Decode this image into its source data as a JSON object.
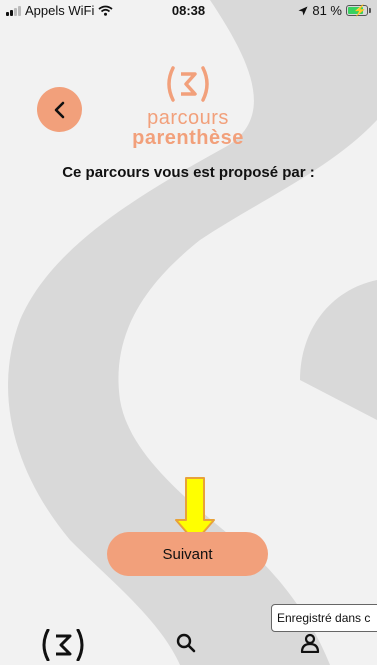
{
  "status_bar": {
    "carrier": "Appels WiFi",
    "time": "08:38",
    "battery_percent": "81 %",
    "battery_level": 0.81,
    "icons": [
      "signal-icon",
      "wifi-icon",
      "location-arrow-icon",
      "battery-charging-icon"
    ]
  },
  "logo": {
    "line1": "parcours",
    "line2": "parenthèse"
  },
  "page": {
    "title": "Ce parcours vous est proposé par :"
  },
  "actions": {
    "back_icon": "chevron-left-icon",
    "next_label": "Suivant"
  },
  "tab_bar": {
    "items": [
      {
        "icon": "logo-home-icon"
      },
      {
        "icon": "search-icon"
      },
      {
        "icon": "profile-icon"
      }
    ]
  },
  "toast": {
    "text": "Enregistré dans c"
  },
  "colors": {
    "accent": "#f2a07b",
    "background": "#f2f2f2",
    "path": "#d9d9d9",
    "annotation_arrow": "#ffff00"
  }
}
